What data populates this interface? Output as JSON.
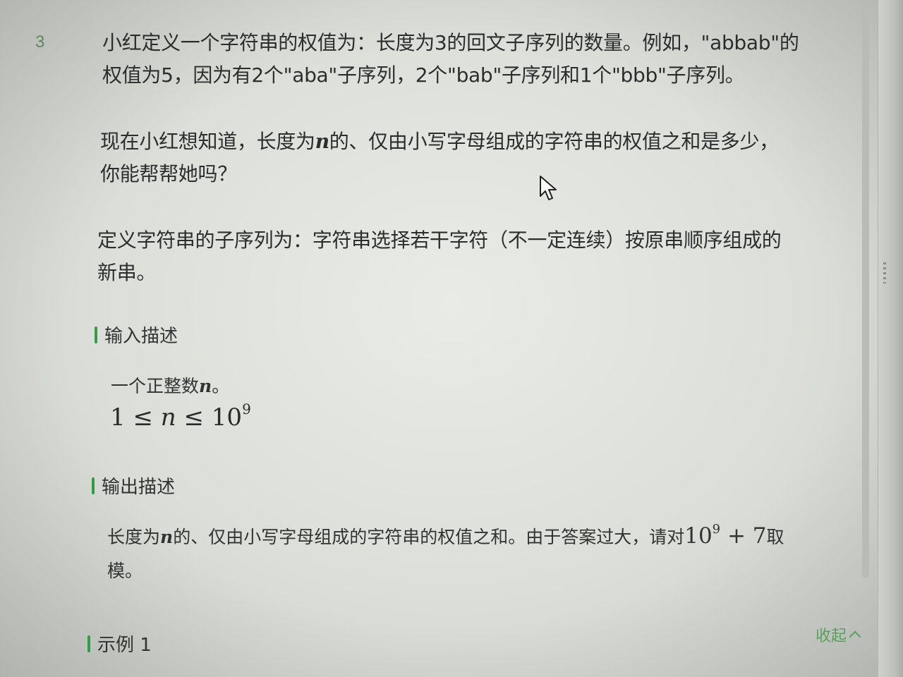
{
  "problem": {
    "line_number": "3",
    "p1": [
      "小红定义一个字符串的权值为：长度为3的回文子序列的数量。例如，\"abbab\"的",
      "权值为5，因为有2个\"aba\"子序列，2个\"bab\"子序列和1个\"bbb\"子序列。"
    ],
    "p2": {
      "row1_before": "现在小红想知道，长度为",
      "var": "n",
      "row1_after": "的、仅由小写字母组成的字符串的权值之和是多少，",
      "row2": "你能帮帮她吗？"
    },
    "p3": [
      "定义字符串的子序列为：字符串选择若干字符（不一定连续）按原串顺序组成的",
      "新串。"
    ]
  },
  "input": {
    "heading": "输入描述",
    "text_before": "一个正整数",
    "var": "n",
    "text_after": "。",
    "formula": {
      "left": "1",
      "op1": "≤",
      "var": "n",
      "op2": "≤",
      "base": "10",
      "exp": "9"
    }
  },
  "output": {
    "heading": "输出描述",
    "row1_before": "长度为",
    "var": "n",
    "row1_mid": "的、仅由小写字母组成的字符串的权值之和。由于答案过大，请对",
    "mod_base": "10",
    "mod_exp": "9",
    "mod_tail": " + 7",
    "row1_after": "取",
    "row2": "模。"
  },
  "example": {
    "heading": "示例 1",
    "collapse_label": "收起"
  },
  "colors": {
    "accent_green": "#2f9e44",
    "link_green": "#5aa05f",
    "line_number": "#5c8a5a"
  },
  "icons": {
    "cursor": "mouse-pointer-icon",
    "collapse": "chevron-up-icon"
  }
}
